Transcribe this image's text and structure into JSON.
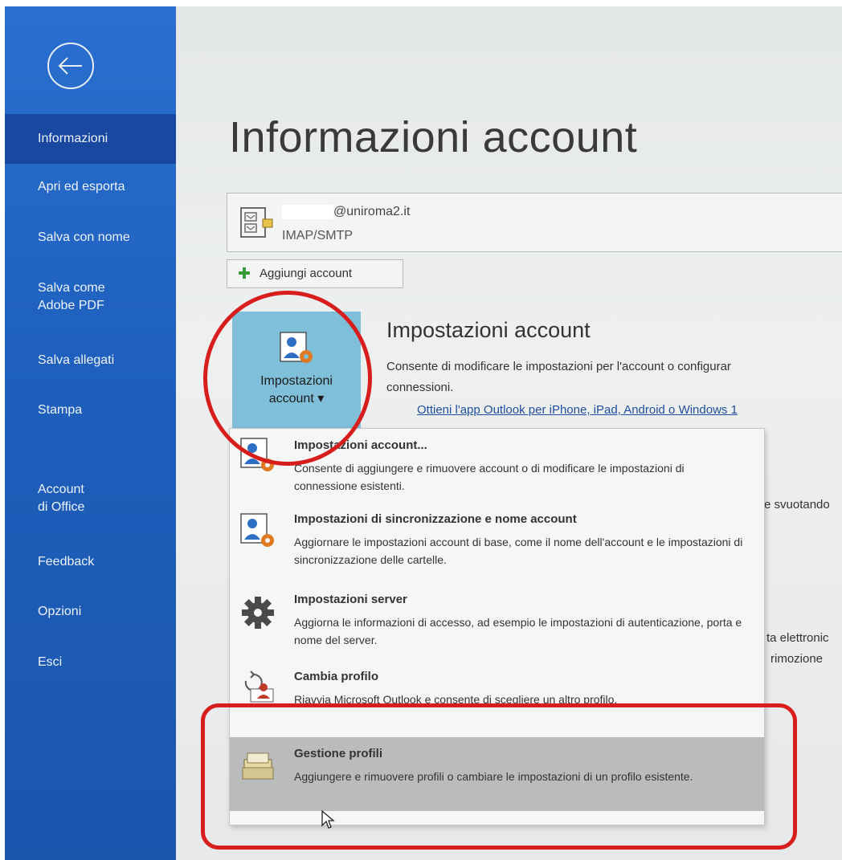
{
  "sidebar": {
    "items": [
      {
        "label": "Informazioni",
        "active": true
      },
      {
        "label": "Apri ed esporta"
      },
      {
        "label": "Salva con nome"
      },
      {
        "label": "Salva come\nAdobe PDF"
      },
      {
        "label": "Salva allegati"
      },
      {
        "label": "Stampa"
      },
      {
        "label": "Account\ndi Office"
      },
      {
        "label": "Feedback"
      },
      {
        "label": "Opzioni"
      },
      {
        "label": "Esci"
      }
    ],
    "back_icon": "back-arrow-icon",
    "color": "#1f62c0"
  },
  "main": {
    "title": "Informazioni account",
    "account": {
      "email": "@uniroma2.it",
      "type": "IMAP/SMTP"
    },
    "add_account_label": "Aggiungi account",
    "settings_tile": {
      "label_line1": "Impostazioni",
      "label_line2": "account ▾"
    },
    "section": {
      "title": "Impostazioni account",
      "desc_line1": "Consente di modificare le impostazioni per l'account o configurar",
      "desc_line2": "connessioni.",
      "link": "Ottieni l'app Outlook per iPhone, iPad, Android o Windows 1"
    },
    "background_fragments": {
      "svuotando": "e svuotando",
      "elettronic": "ta elettronic",
      "rimozione": "rimozione"
    }
  },
  "dropdown": {
    "items": [
      {
        "title": "Impostazioni account...",
        "desc": "Consente di aggiungere e rimuovere account o di modificare le impostazioni di connessione esistenti.",
        "icon": "account-settings-icon"
      },
      {
        "title": "Impostazioni di sincronizzazione e nome account",
        "desc": "Aggiornare le impostazioni account di base, come il nome dell'account e le impostazioni di sincronizzazione delle cartelle.",
        "icon": "account-sync-icon"
      },
      {
        "title": "Impostazioni server",
        "desc": "Aggiorna le informazioni di accesso, ad esempio le impostazioni di autenticazione, porta e nome del server.",
        "icon": "gear-icon"
      },
      {
        "title": "Cambia profilo",
        "desc": "Riavvia Microsoft Outlook e consente di scegliere un altro profilo.",
        "icon": "change-profile-icon"
      },
      {
        "title": "Gestione profili",
        "desc": "Aggiungere e rimuovere profili o cambiare le impostazioni di un profilo esistente.",
        "icon": "manage-profiles-icon",
        "highlighted": true
      }
    ]
  },
  "annotations": {
    "color": "#d81d1d"
  }
}
